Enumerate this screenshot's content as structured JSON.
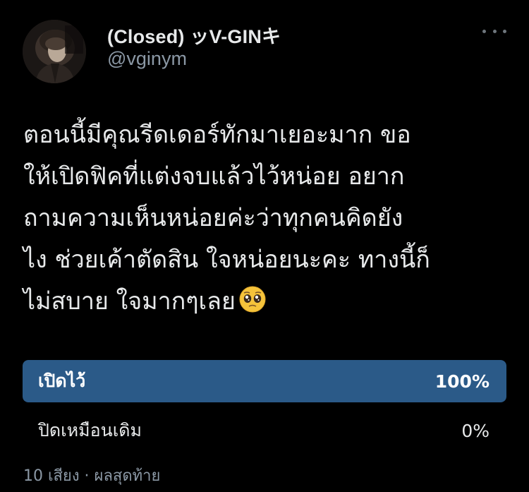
{
  "user": {
    "display_name": "(Closed) ッV-GINキ",
    "handle": "@vginym"
  },
  "tweet": {
    "lines": [
      "ตอนนี้มีคุณรีดเดอร์ทักมาเยอะมาก ขอ",
      "ให้เปิดฟิคที่แต่งจบแล้วไว้หน่อย อยาก",
      "ถามความเห็นหน่อยค่ะว่าทุกคนคิดยัง",
      "ไง ช่วยเค้าตัดสิน ใจหน่อยนะคะ ทางนี้ก็",
      "ไม่สบาย ใจมากๆเลย"
    ],
    "emoji_icon": "pleading-face-emoji"
  },
  "poll": {
    "options": [
      {
        "label": "เปิดไว้",
        "percent_text": "100%",
        "share": 1.0,
        "winner": true
      },
      {
        "label": "ปิดเหมือนเดิม",
        "percent_text": "0%",
        "share": 0.0,
        "winner": false
      }
    ],
    "meta": "10 เสียง · ผลสุดท้าย"
  },
  "colors": {
    "background": "#000000",
    "primary_text": "#e7e9ea",
    "secondary_text": "#8b98a5",
    "poll_winner_fill": "#2b5a88"
  },
  "icons": {
    "more": "more-dots-icon",
    "avatar": "profile-avatar"
  }
}
